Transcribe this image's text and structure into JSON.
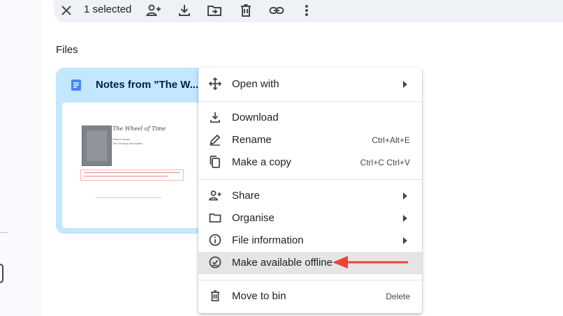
{
  "selection_bar": {
    "count_label": "1 selected",
    "actions": [
      {
        "icon": "close-icon",
        "name": "clear-selection-button"
      },
      {
        "icon": "share-person-add-icon",
        "name": "share-button"
      },
      {
        "icon": "download-icon",
        "name": "download-button"
      },
      {
        "icon": "move-folder-icon",
        "name": "move-button"
      },
      {
        "icon": "trash-icon",
        "name": "move-to-bin-button"
      },
      {
        "icon": "link-icon",
        "name": "copy-link-button"
      },
      {
        "icon": "more-vert-icon",
        "name": "more-actions-button"
      }
    ]
  },
  "files_section": {
    "heading": "Files",
    "file": {
      "name": "Notes from \"The W...",
      "icon": "google-docs-icon",
      "thumbnail": {
        "title": "The Wheel of Time",
        "meta_line1": "Robert Jordan",
        "meta_line2": "Tom Doherty Associates"
      }
    }
  },
  "context_menu": {
    "groups": [
      [
        {
          "label": "Open with",
          "icon": "move-arrows-icon",
          "submenu": true
        }
      ],
      [
        {
          "label": "Download",
          "icon": "download-icon",
          "shortcut": ""
        },
        {
          "label": "Rename",
          "icon": "pencil-icon",
          "shortcut": "Ctrl+Alt+E"
        },
        {
          "label": "Make a copy",
          "icon": "copy-icon",
          "shortcut": "Ctrl+C Ctrl+V"
        }
      ],
      [
        {
          "label": "Share",
          "icon": "person-add-icon",
          "submenu": true
        },
        {
          "label": "Organise",
          "icon": "folder-icon",
          "submenu": true
        },
        {
          "label": "File information",
          "icon": "info-icon",
          "submenu": true
        },
        {
          "label": "Make available offline",
          "icon": "offline-check-icon",
          "highlighted": true
        }
      ],
      [
        {
          "label": "Move to bin",
          "icon": "trash-icon",
          "shortcut": "Delete"
        }
      ]
    ]
  },
  "colors": {
    "card_selected": "#c2e7ff",
    "toolbar_bg": "#eef1f6",
    "menu_highlight": "#e5e5e5",
    "annotation_arrow": "#ea4335",
    "docs_blue": "#4285f4"
  }
}
